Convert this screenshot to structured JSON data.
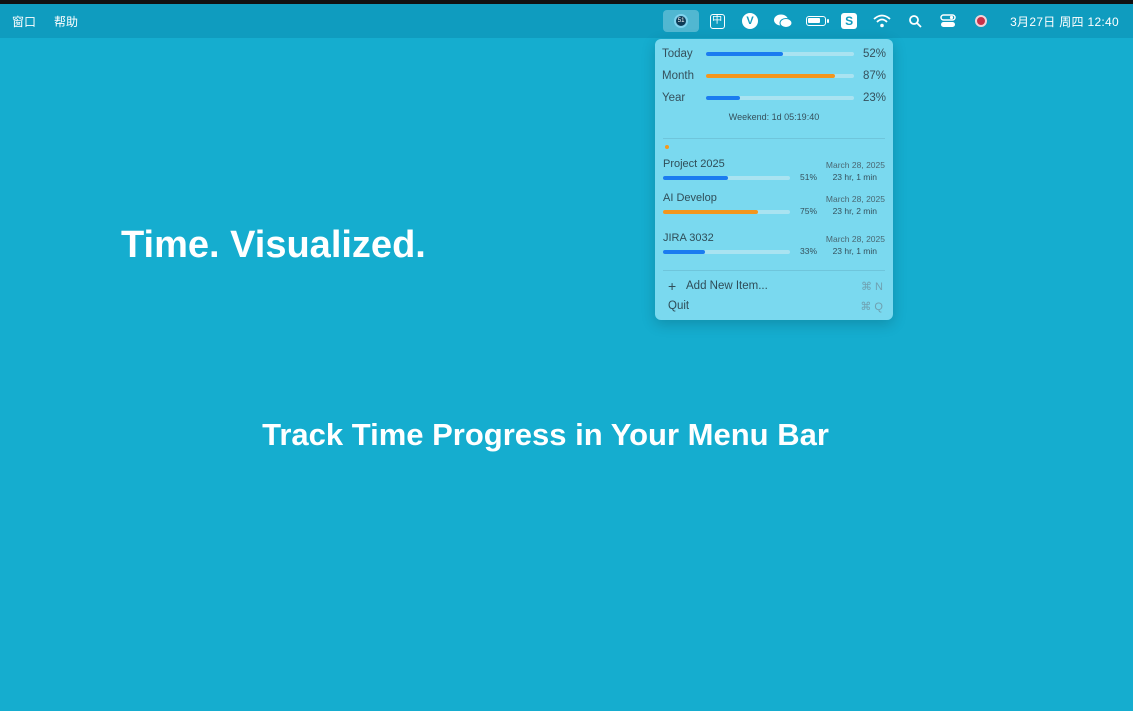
{
  "menubar": {
    "left_items": [
      "窗口",
      "帮助"
    ],
    "clock": "3月27日 周四  12:40",
    "ime_label": "中",
    "app_badge": "51"
  },
  "dropdown": {
    "progress": [
      {
        "label": "Today",
        "pct_text": "52%",
        "fraction": 0.52,
        "color": "#1a7cf0"
      },
      {
        "label": "Month",
        "pct_text": "87%",
        "fraction": 0.87,
        "color": "#f3961d"
      },
      {
        "label": "Year",
        "pct_text": "23%",
        "fraction": 0.23,
        "color": "#1a7cf0"
      }
    ],
    "weekend": "Weekend: 1d 05:19:40",
    "items": [
      {
        "name": "Project 2025",
        "date": "March 28, 2025",
        "pct_text": "51%",
        "fraction": 0.51,
        "remain": "23 hr, 1 min",
        "color": "#1a7cf0"
      },
      {
        "name": "AI Develop",
        "date": "March 28, 2025",
        "pct_text": "75%",
        "fraction": 0.75,
        "remain": "23 hr, 2 min",
        "color": "#f3961d"
      },
      {
        "name": "JIRA 3032",
        "date": "March 28, 2025",
        "pct_text": "33%",
        "fraction": 0.33,
        "remain": "23 hr, 1 min",
        "color": "#1a7cf0"
      }
    ],
    "add_label": "Add New Item...",
    "add_shortcut": "⌘ N",
    "quit_label": "Quit",
    "quit_shortcut": "⌘ Q"
  },
  "hero": {
    "headline": "Time. Visualized.",
    "subline": "Track Time Progress in Your Menu Bar"
  }
}
